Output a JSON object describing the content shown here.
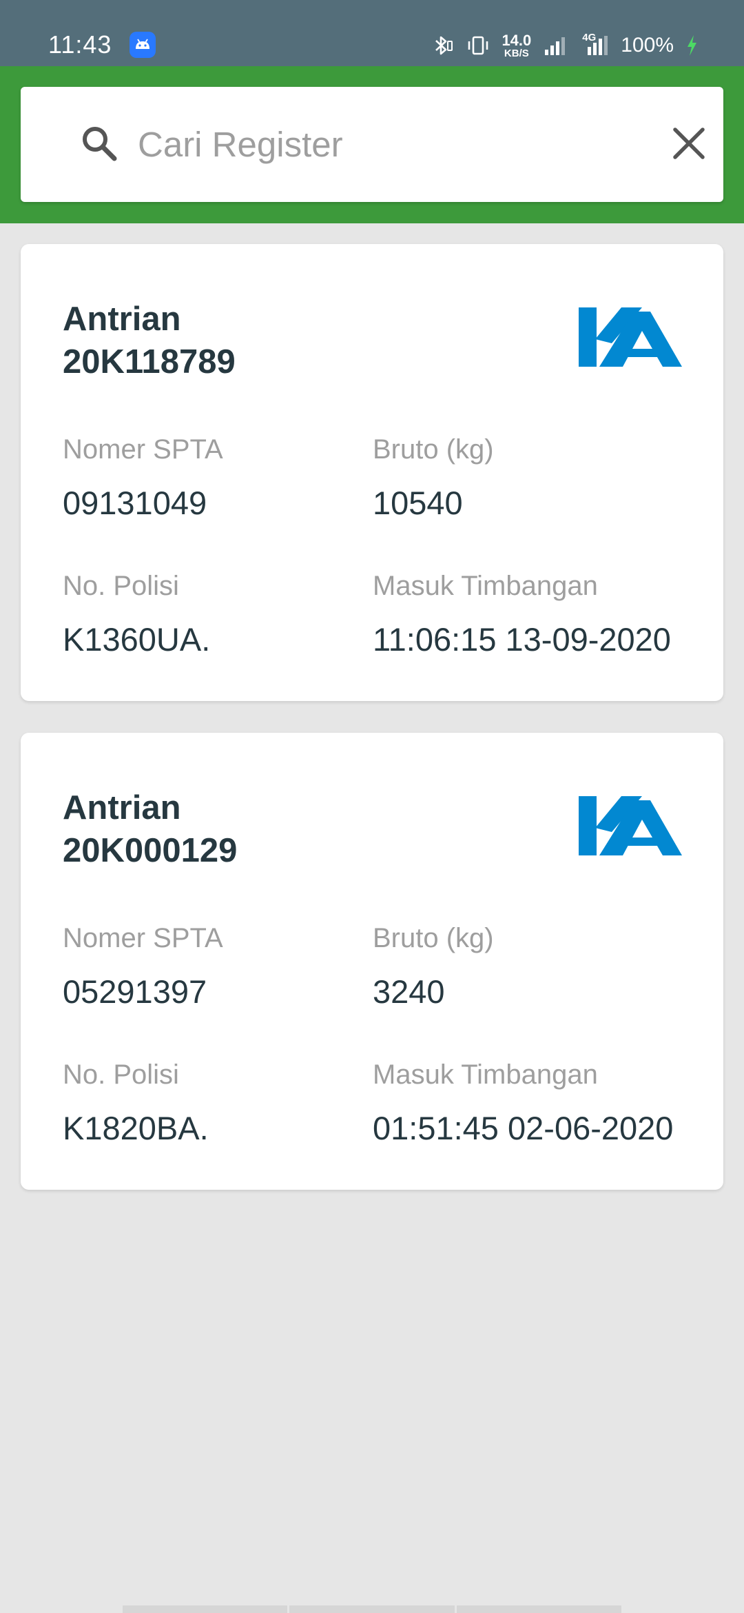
{
  "status_bar": {
    "time": "11:43",
    "net_speed_value": "14.0",
    "net_speed_unit": "KB/S",
    "network_type": "4G",
    "battery": "100%"
  },
  "search": {
    "placeholder": "Cari Register",
    "value": ""
  },
  "labels": {
    "nomer_spta": "Nomer SPTA",
    "bruto": "Bruto (kg)",
    "no_polisi": "No. Polisi",
    "masuk_timbangan": "Masuk Timbangan"
  },
  "cards": [
    {
      "title_prefix": "Antrian",
      "queue_number": "20K118789",
      "logo_text": "KA",
      "nomer_spta": "09131049",
      "bruto": "10540",
      "no_polisi": "K1360UA.",
      "masuk_timbangan": "11:06:15 13-09-2020"
    },
    {
      "title_prefix": "Antrian",
      "queue_number": "20K000129",
      "logo_text": "KA",
      "nomer_spta": "05291397",
      "bruto": "3240",
      "no_polisi": "K1820BA.",
      "masuk_timbangan": "01:51:45 02-06-2020"
    }
  ],
  "colors": {
    "status_bar": "#546e7a",
    "app_bar": "#3d9a3b",
    "logo": "#0288d1",
    "background": "#e6e6e6"
  },
  "icons": {
    "search": "search-icon",
    "close": "close-icon",
    "android": "android-icon",
    "bluetooth": "bluetooth-icon",
    "vibrate": "vibrate-icon",
    "signal": "signal-icon",
    "charging": "charging-icon"
  }
}
